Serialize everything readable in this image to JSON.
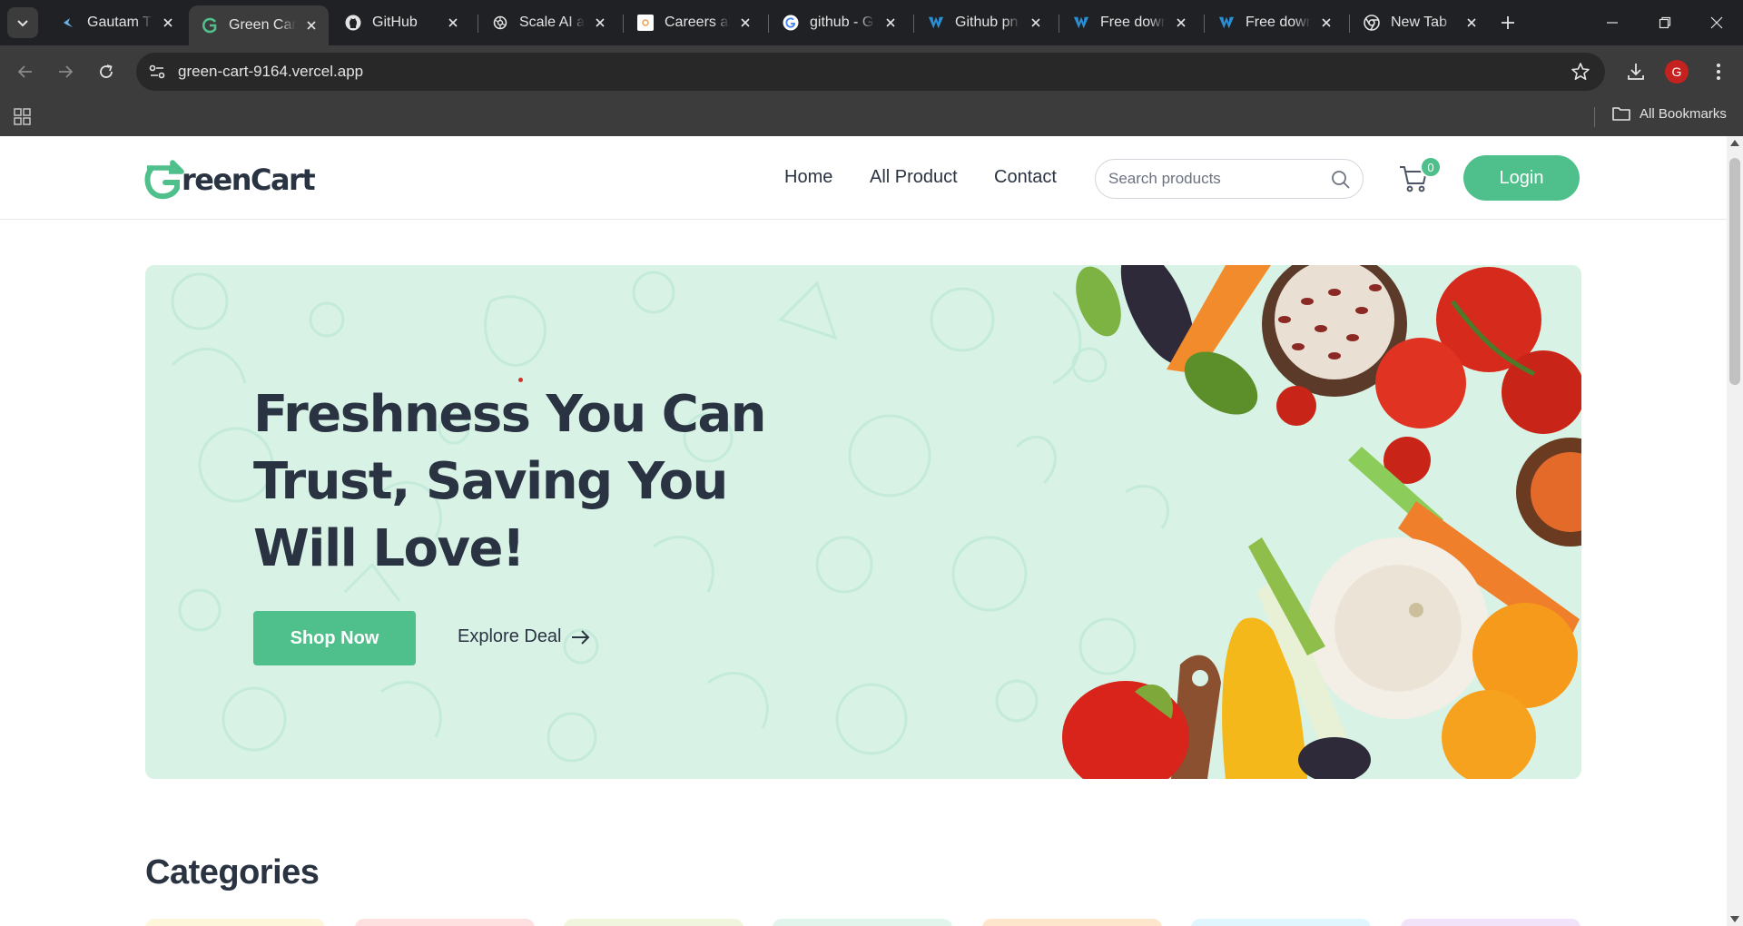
{
  "browser": {
    "tabs": [
      {
        "title": "Gautam Th",
        "icon": "gautam-favicon"
      },
      {
        "title": "Green Cart",
        "icon": "greencart-favicon",
        "active": true
      },
      {
        "title": "GitHub",
        "icon": "github-favicon"
      },
      {
        "title": "Scale AI an",
        "icon": "openai-favicon"
      },
      {
        "title": "Careers at",
        "icon": "careers-favicon"
      },
      {
        "title": "github - G",
        "icon": "google-favicon"
      },
      {
        "title": "Github pn",
        "icon": "freepik-favicon"
      },
      {
        "title": "Free down",
        "icon": "freepik-favicon"
      },
      {
        "title": "Free down",
        "icon": "freepik-favicon"
      },
      {
        "title": "New Tab",
        "icon": "chrome-favicon"
      }
    ],
    "url": "green-cart-9164.vercel.app",
    "profile_initial": "G",
    "bookmarks_label": "All Bookmarks"
  },
  "site": {
    "logo_text": "reenCart",
    "nav": [
      "Home",
      "All Product",
      "Contact"
    ],
    "search_placeholder": "Search products",
    "cart_count": "0",
    "login_label": "Login",
    "accent_color": "#4fbf8b",
    "text_color": "#2a3342"
  },
  "hero": {
    "title": "Freshness You Can Trust, Saving You Will Love!",
    "shop_label": "Shop Now",
    "explore_label": "Explore Deal",
    "background": "#d8f3e6"
  },
  "categories": {
    "title": "Categories",
    "card_colors": [
      "#fef6da",
      "#fee0e0",
      "#f0f5de",
      "#e1f5ec",
      "#fee6cd",
      "#e0f6fe",
      "#f1e3f9"
    ]
  }
}
